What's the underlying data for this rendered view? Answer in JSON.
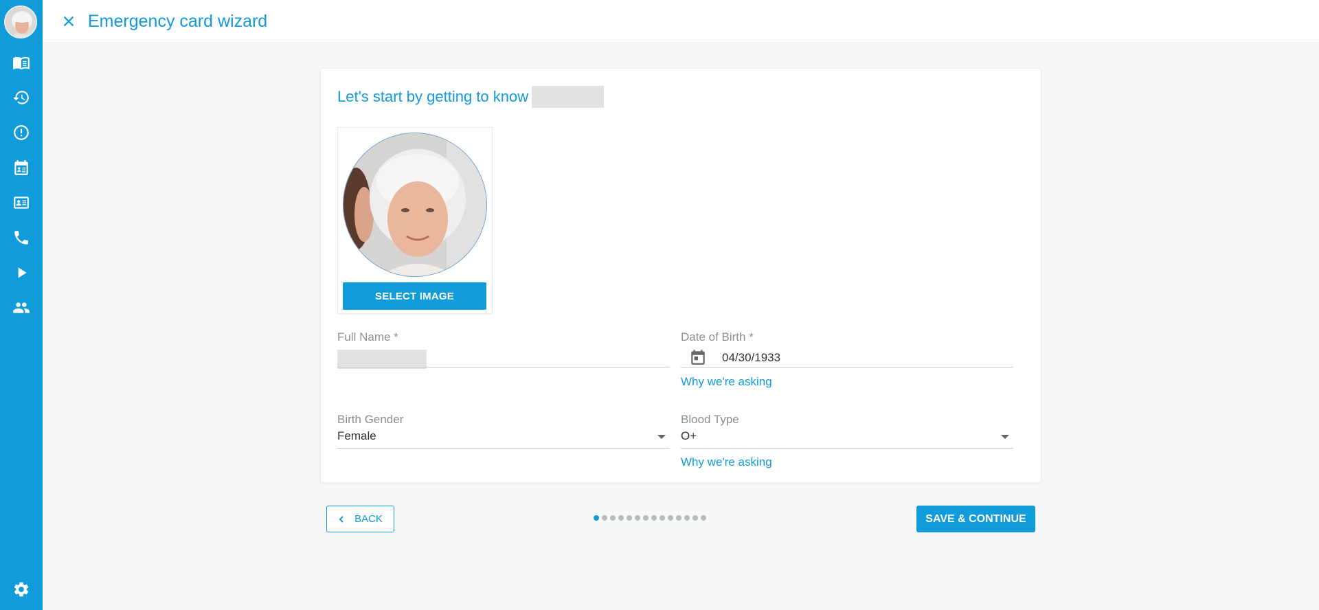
{
  "colors": {
    "accent": "#109bdb",
    "sidebar": "#109bdb",
    "redaction": "#e2e2e2"
  },
  "sidebar": {
    "items": [
      {
        "icon": "book-icon"
      },
      {
        "icon": "history-icon"
      },
      {
        "icon": "alert-icon"
      },
      {
        "icon": "calendar-contact-icon"
      },
      {
        "icon": "id-card-icon"
      },
      {
        "icon": "phone-icon"
      },
      {
        "icon": "play-icon"
      },
      {
        "icon": "people-icon"
      }
    ],
    "footer_icon": "gear-icon"
  },
  "header": {
    "title": "Emergency card wizard",
    "close_icon": "close-icon"
  },
  "card": {
    "heading": "Let's start by getting to know",
    "select_image_label": "SELECT IMAGE",
    "fields": {
      "full_name": {
        "label": "Full Name *",
        "value": ""
      },
      "date_of_birth": {
        "label": "Date of Birth *",
        "value": "04/30/1933",
        "help_link": "Why we're asking"
      },
      "birth_gender": {
        "label": "Birth Gender",
        "value": "Female"
      },
      "blood_type": {
        "label": "Blood Type",
        "value": "O+",
        "help_link": "Why we're asking"
      }
    }
  },
  "footer": {
    "back_label": "BACK",
    "save_label": "SAVE & CONTINUE",
    "step_total": 14,
    "step_current": 1
  }
}
